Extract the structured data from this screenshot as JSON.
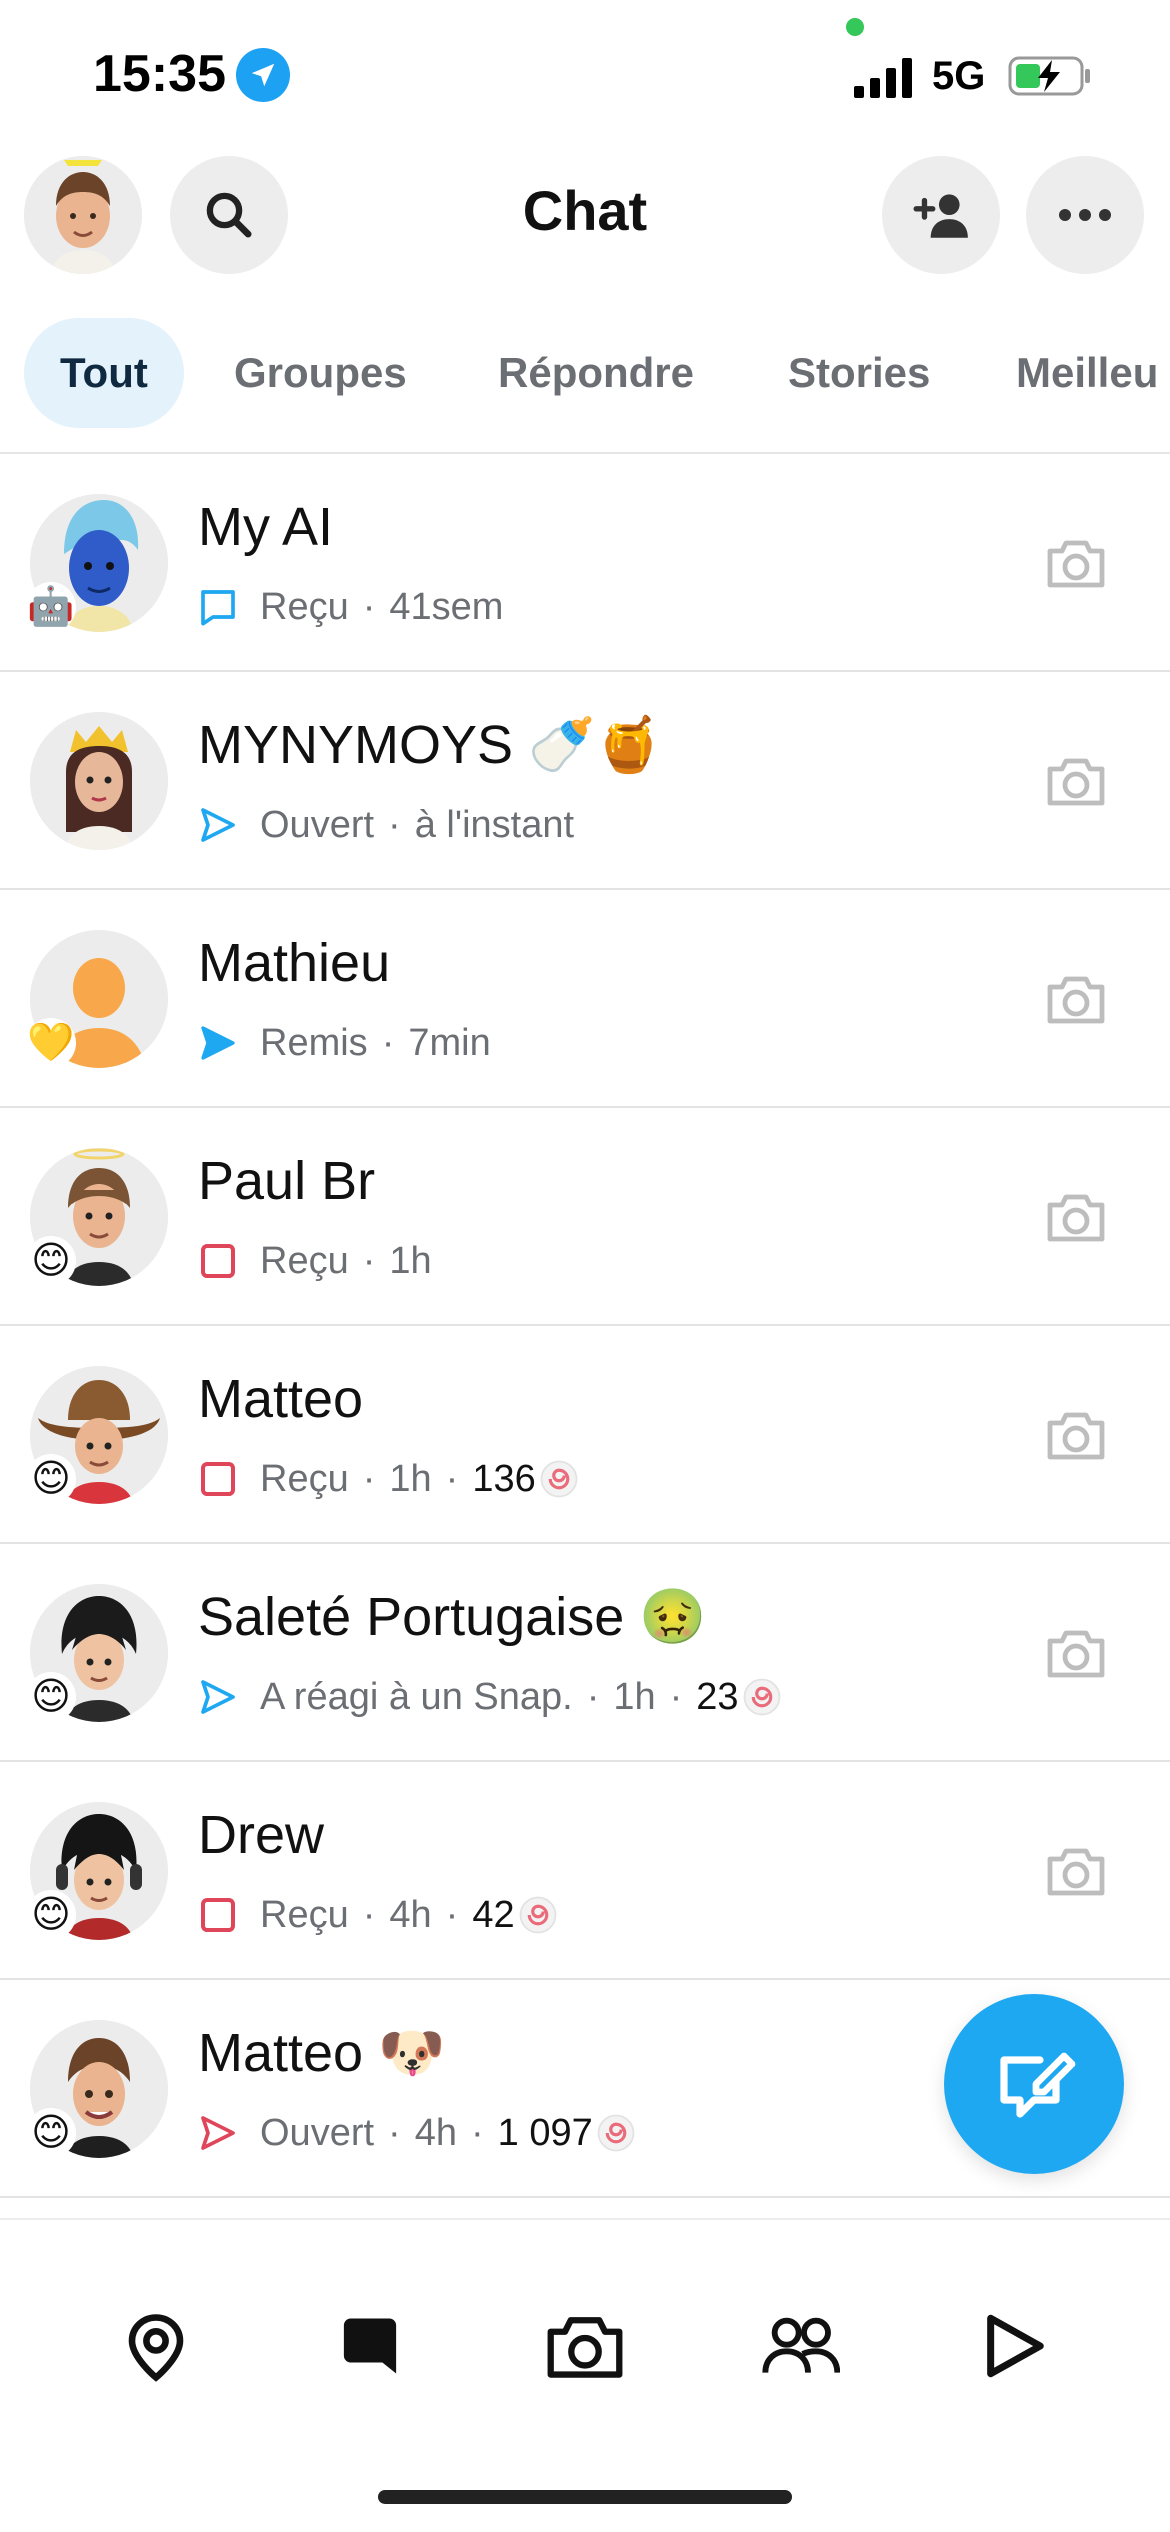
{
  "status_bar": {
    "time": "15:35",
    "network": "5G"
  },
  "header": {
    "title": "Chat"
  },
  "tabs": [
    {
      "label": "Tout",
      "active": true
    },
    {
      "label": "Groupes",
      "active": false
    },
    {
      "label": "Répondre",
      "active": false
    },
    {
      "label": "Stories",
      "active": false
    },
    {
      "label": "Meilleu",
      "active": false
    }
  ],
  "chats": [
    {
      "name": "My AI",
      "status": "Reçu",
      "time": "41sem",
      "streak": "",
      "status_icon": "chat-outline-blue-icon",
      "badge": "🤖"
    },
    {
      "name": "MYNYMOYS 🍼🍯",
      "status": "Ouvert",
      "time": "à l'instant",
      "streak": "",
      "status_icon": "arrow-outline-blue-icon",
      "badge": ""
    },
    {
      "name": "Mathieu",
      "status": "Remis",
      "time": "7min",
      "streak": "",
      "status_icon": "arrow-filled-blue-icon",
      "badge": "💛"
    },
    {
      "name": "Paul Br",
      "status": "Reçu",
      "time": "1h",
      "streak": "",
      "status_icon": "square-outline-red-icon",
      "badge": "😊"
    },
    {
      "name": "Matteo",
      "status": "Reçu",
      "time": "1h",
      "streak": "136",
      "status_icon": "square-outline-red-icon",
      "badge": "😊"
    },
    {
      "name": "Saleté Portugaise 🤢",
      "status": "A réagi à un Snap.",
      "time": "1h",
      "streak": "23",
      "status_icon": "arrow-outline-blue-icon",
      "badge": "😊"
    },
    {
      "name": "Drew",
      "status": "Reçu",
      "time": "4h",
      "streak": "42",
      "status_icon": "square-outline-red-icon",
      "badge": "😊"
    },
    {
      "name": "Matteo 🐶",
      "status": "Ouvert",
      "time": "4h",
      "streak": "1 097",
      "status_icon": "arrow-outline-red-icon",
      "badge": "😊"
    }
  ],
  "colors": {
    "accent_blue": "#1ea8f1",
    "red": "#e0465a",
    "tab_active_bg": "#e3f2fb"
  },
  "nav": [
    {
      "name": "map-icon"
    },
    {
      "name": "chat-icon",
      "active": true
    },
    {
      "name": "camera-icon"
    },
    {
      "name": "friends-icon"
    },
    {
      "name": "spotlight-play-icon"
    }
  ]
}
